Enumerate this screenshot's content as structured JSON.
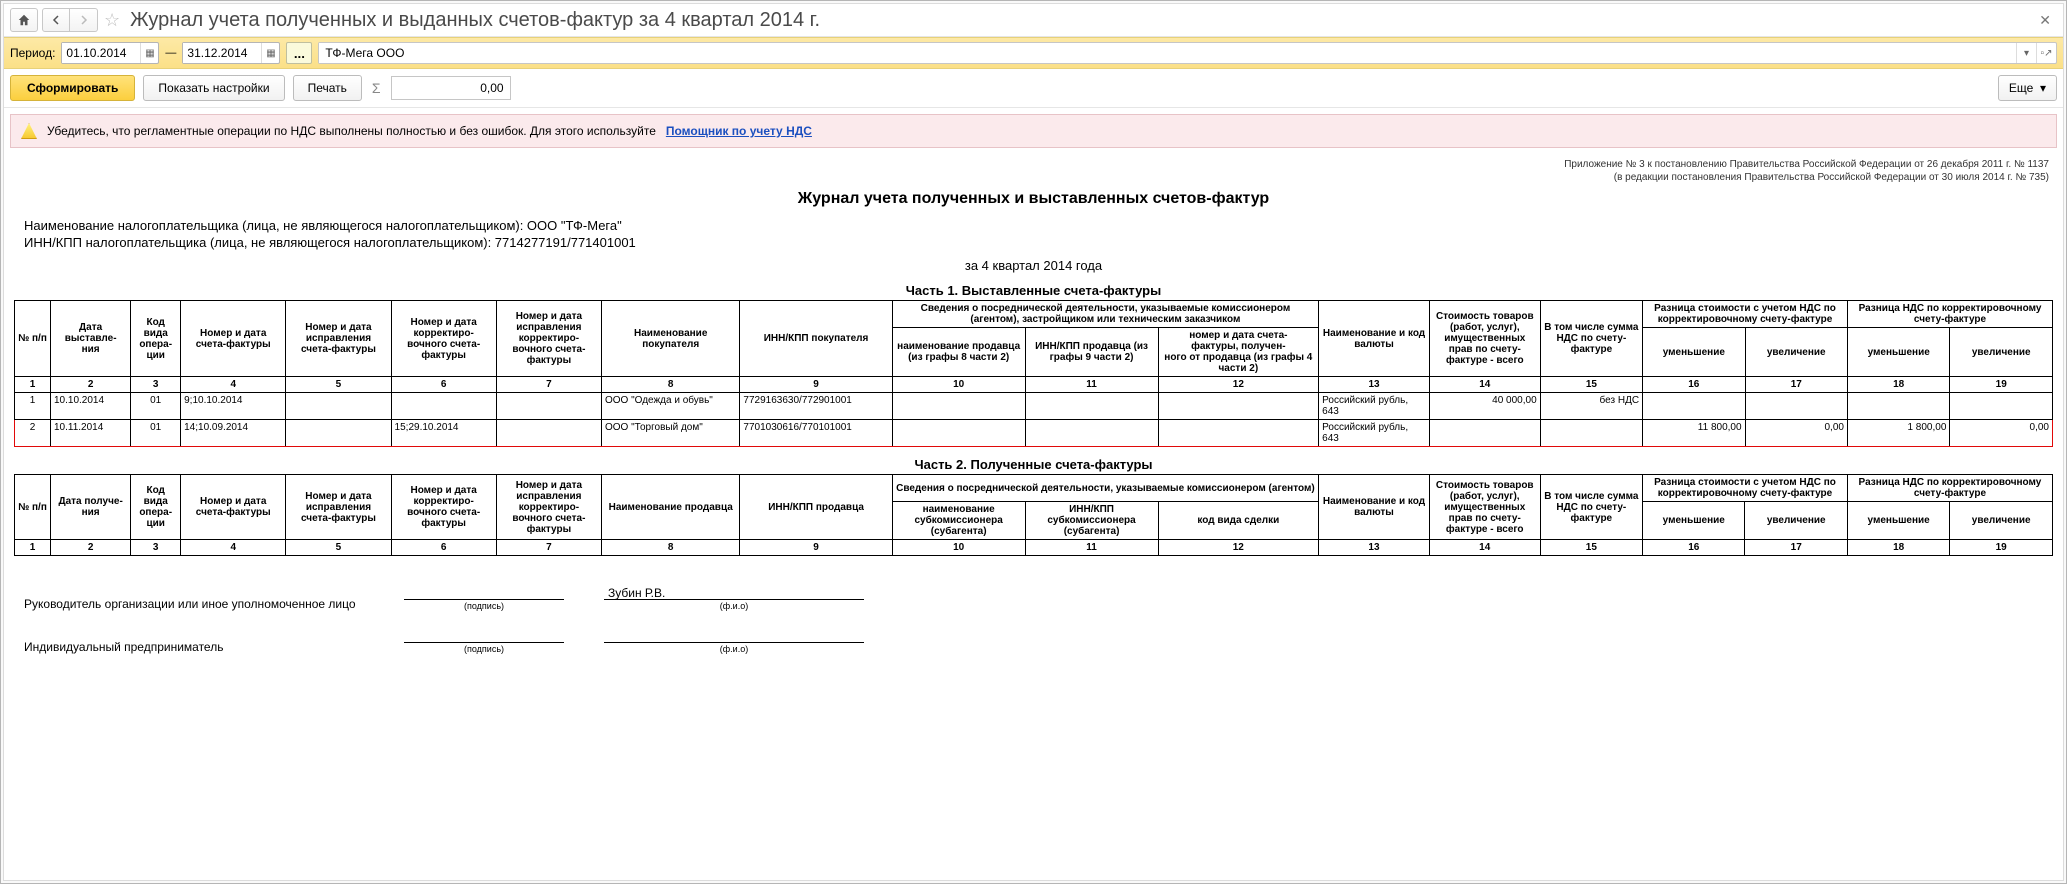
{
  "titlebar": {
    "title": "Журнал учета полученных и выданных счетов-фактур за 4 квартал 2014 г."
  },
  "period": {
    "label": "Период:",
    "from": "01.10.2014",
    "to": "31.12.2014",
    "dash": "—",
    "org": "ТФ-Мега ООО"
  },
  "toolbar": {
    "generate": "Сформировать",
    "show_settings": "Показать настройки",
    "print": "Печать",
    "sum": "0,00",
    "more": "Еще"
  },
  "warning": {
    "text": "Убедитесь, что регламентные операции по НДС выполнены полностью и без ошибок. Для этого используйте",
    "link": "Помощник по учету НДС"
  },
  "reg_note": {
    "l1": "Приложение № 3 к постановлению Правительства Российской Федерации от 26 декабря 2011 г. № 1137",
    "l2": "(в редакции постановления Правительства Российской Федерации от 30 июля 2014 г. № 735)"
  },
  "report": {
    "title": "Журнал учета полученных и выставленных счетов-фактур",
    "taxpayer_name_label": "Наименование налогоплательщика (лица, не являющегося налогоплательщиком): ООО \"ТФ-Мега\"",
    "taxpayer_inn_label": "ИНН/КПП налогоплательщика (лица, не являющегося налогоплательщиком): 7714277191/771401001",
    "quarter": "за 4 квартал 2014 года"
  },
  "part1": {
    "title": "Часть 1. Выставленные счета-фактуры",
    "headers": {
      "c1": "№ п/п",
      "c2": "Дата выставле-\nния",
      "c3": "Код вида опера-\nции",
      "c4": "Номер и дата счета-фактуры",
      "c5": "Номер и дата исправления счета-фактуры",
      "c6": "Номер и дата корректиро-\nвочного счета-фактуры",
      "c7": "Номер и дата исправления корректиро-\nвочного счета-\nфактуры",
      "c8": "Наименование покупателя",
      "c9": "ИНН/КПП покупателя",
      "g10_12": "Сведения о посреднической деятельности, указываемые комиссионером (агентом), застройщиком или техническим заказчиком",
      "c10": "наименование продавца (из графы 8 части 2)",
      "c11": "ИНН/КПП продавца (из графы 9 части 2)",
      "c12": "номер и дата счета-\nфактуры, получен-\nного от продавца (из графы 4 части 2)",
      "c13": "Наименование и код валюты",
      "c14": "Стоимость товаров (работ, услуг), имущественных прав по счету-\nфактуре - всего",
      "c15": "В том числе сумма НДС по счету-фактуре",
      "g16_17": "Разница стоимости с учетом НДС по корректировочному счету-фактуре",
      "c16": "уменьшение",
      "c17": "увеличение",
      "g18_19": "Разница НДС по корректировочному счету-фактуре",
      "c18": "уменьшение",
      "c19": "увеличение"
    },
    "rows": [
      {
        "n": "1",
        "date": "10.10.2014",
        "op": "01",
        "sf": "9;10.10.2014",
        "fix": "",
        "corr": "",
        "corrfix": "",
        "buyer": "ООО \"Одежда и обувь\"",
        "inn": "7729163630/772901001",
        "s10": "",
        "s11": "",
        "s12": "",
        "curr": "Российский рубль, 643",
        "cost": "40 000,00",
        "vat": "без НДС",
        "d16": "",
        "d17": "",
        "d18": "",
        "d19": "",
        "hl": false
      },
      {
        "n": "2",
        "date": "10.11.2014",
        "op": "01",
        "sf": "14;10.09.2014",
        "fix": "",
        "corr": "15;29.10.2014",
        "corrfix": "",
        "buyer": "ООО \"Торговый дом\"",
        "inn": "7701030616/770101001",
        "s10": "",
        "s11": "",
        "s12": "",
        "curr": "Российский рубль, 643",
        "cost": "",
        "vat": "",
        "d16": "11 800,00",
        "d17": "0,00",
        "d18": "1 800,00",
        "d19": "0,00",
        "hl": true
      }
    ]
  },
  "part2": {
    "title": "Часть 2. Полученные счета-фактуры",
    "headers": {
      "c1": "№ п/п",
      "c2": "Дата получе-\nния",
      "c3": "Код вида опера-\nции",
      "c4": "Номер и дата счета-фактуры",
      "c5": "Номер и дата исправления счета-фактуры",
      "c6": "Номер и дата корректиро-\nвочного счета-фактуры",
      "c7": "Номер и дата исправления корректиро-\nвочного счета-\nфактуры",
      "c8": "Наименование продавца",
      "c9": "ИНН/КПП продавца",
      "g10_12": "Сведения о посреднической деятельности, указываемые комиссионером (агентом)",
      "c10": "наименование субкомиссионера (субагента)",
      "c11": "ИНН/КПП субкомиссионера (субагента)",
      "c12": "код вида сделки",
      "c13": "Наименование и код валюты",
      "c14": "Стоимость товаров (работ, услуг), имущественных прав по счету-\nфактуре - всего",
      "c15": "В том числе сумма НДС по счету-фактуре",
      "g16_17": "Разница стоимости с учетом НДС по корректировочному счету-фактуре",
      "c16": "уменьшение",
      "c17": "увеличение",
      "g18_19": "Разница НДС по корректировочному счету-фактуре",
      "c18": "уменьшение",
      "c19": "увеличение"
    }
  },
  "signs": {
    "head_label": "Руководитель организации или иное уполномоченное лицо",
    "ip_label": "Индивидуальный предприниматель",
    "sign_cap": "(подпись)",
    "fio_cap": "(ф.и.о)",
    "head_fio": "Зубин Р.В."
  }
}
